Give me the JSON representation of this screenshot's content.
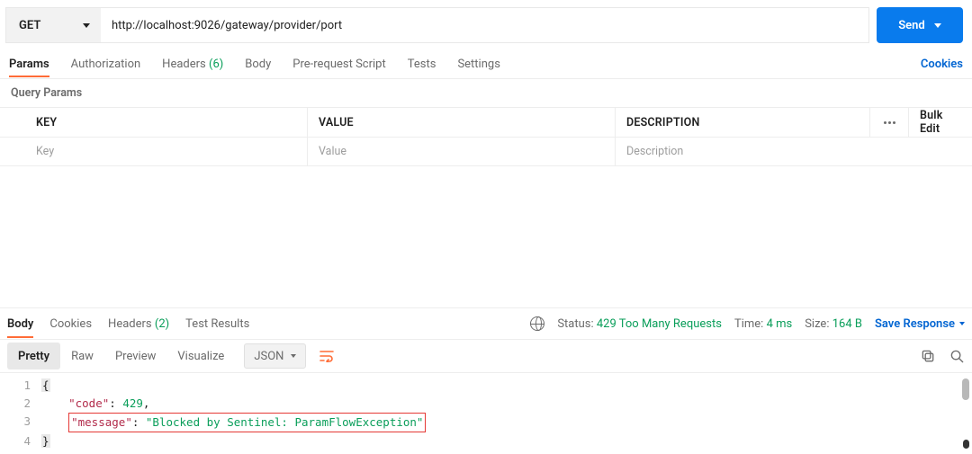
{
  "request": {
    "method": "GET",
    "url": "http://localhost:9026/gateway/provider/port",
    "send_label": "Send"
  },
  "req_tabs": {
    "params": "Params",
    "auth": "Authorization",
    "headers": "Headers",
    "headers_count": "(6)",
    "body": "Body",
    "prereq": "Pre-request Script",
    "tests": "Tests",
    "settings": "Settings",
    "cookies": "Cookies"
  },
  "params": {
    "title": "Query Params",
    "key_hdr": "KEY",
    "val_hdr": "VALUE",
    "desc_hdr": "DESCRIPTION",
    "bulk": "Bulk Edit",
    "key_ph": "Key",
    "val_ph": "Value",
    "desc_ph": "Description"
  },
  "resp_tabs": {
    "body": "Body",
    "cookies": "Cookies",
    "headers": "Headers",
    "headers_count": "(2)",
    "test_results": "Test Results"
  },
  "status": {
    "status_lbl": "Status:",
    "status_val": "429 Too Many Requests",
    "time_lbl": "Time:",
    "time_val": "4 ms",
    "size_lbl": "Size:",
    "size_val": "164 B",
    "save": "Save Response"
  },
  "fmt": {
    "pretty": "Pretty",
    "raw": "Raw",
    "preview": "Preview",
    "visualize": "Visualize",
    "lang": "JSON"
  },
  "body": {
    "l1": "{",
    "l2_k": "\"code\"",
    "l2_c": ": ",
    "l2_v": "429",
    "l2_e": ",",
    "l3_k": "\"message\"",
    "l3_c": ": ",
    "l3_v": "\"Blocked by Sentinel: ParamFlowException\"",
    "l4": "}",
    "n1": "1",
    "n2": "2",
    "n3": "3",
    "n4": "4"
  }
}
